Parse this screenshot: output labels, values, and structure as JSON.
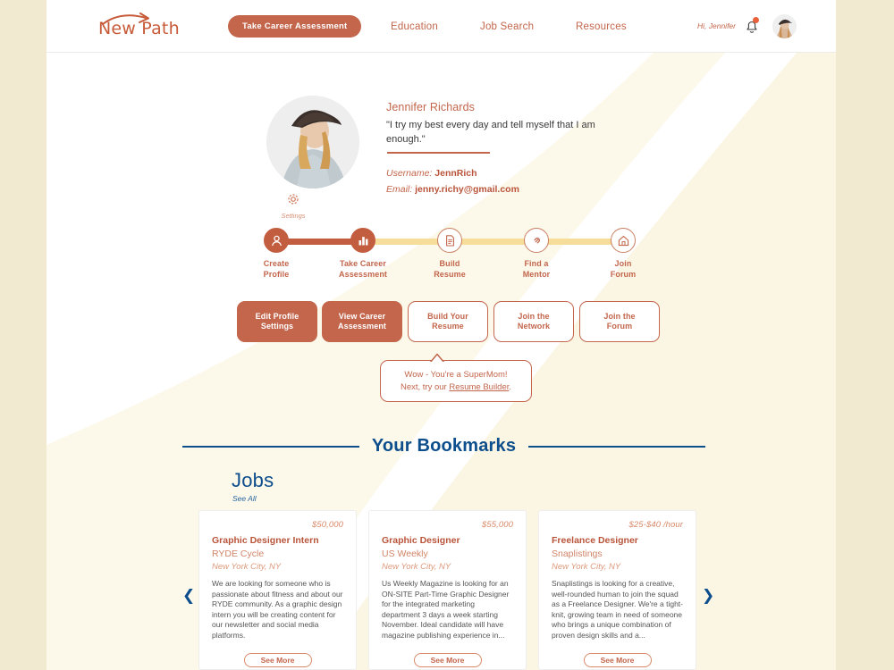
{
  "brand": {
    "name": "New Path",
    "accent": "#c3664c",
    "blue": "#0d4e8c",
    "cream": "#f2ead0",
    "gold": "#f6dd9a"
  },
  "header": {
    "logo_text": "New Path",
    "cta_label": "Take Career Assessment",
    "nav": [
      {
        "label": "Education"
      },
      {
        "label": "Job Search"
      },
      {
        "label": "Resources"
      }
    ],
    "greeting": "Hi, Jennifer",
    "bell_icon": "notification-bell-icon",
    "avatar_icon": "user-avatar"
  },
  "profile": {
    "name": "Jennifer Richards",
    "quote": "\"I try my best every day and tell myself that I am enough.\"",
    "username_label": "Username:",
    "username_value": "JennRich",
    "email_label": "Email:",
    "email_value": "jenny.richy@gmail.com",
    "settings_label": "Settings",
    "settings_icon": "gear-icon"
  },
  "stepper": {
    "steps": [
      {
        "label": "Create\nProfile",
        "icon": "person-icon",
        "state": "done"
      },
      {
        "label": "Take Career\nAssessment",
        "icon": "bar-chart-icon",
        "state": "done"
      },
      {
        "label": "Build\nResume",
        "icon": "document-icon",
        "state": "todo"
      },
      {
        "label": "Find a\nMentor",
        "icon": "link-icon",
        "state": "todo"
      },
      {
        "label": "Join\nForum",
        "icon": "home-icon",
        "state": "todo"
      }
    ]
  },
  "actions": [
    {
      "label": "Edit Profile\nSettings",
      "style": "solid"
    },
    {
      "label": "View Career\nAssessment",
      "style": "solid"
    },
    {
      "label": "Build Your\nResume",
      "style": "ghost"
    },
    {
      "label": "Join the\nNetwork",
      "style": "ghost"
    },
    {
      "label": "Join the\nForum",
      "style": "ghost"
    }
  ],
  "callout": {
    "line1": "Wow - You're a SuperMom!",
    "line2_pre": "Next, try our ",
    "link": "Resume Builder",
    "line2_post": "."
  },
  "bookmarks": {
    "title": "Your Bookmarks",
    "section_title": "Jobs",
    "see_all": "See All",
    "prev_icon": "chevron-left-icon",
    "next_icon": "chevron-right-icon",
    "see_more_label": "See More",
    "cards": [
      {
        "salary": "$50,000",
        "title": "Graphic Designer Intern",
        "company": "RYDE Cycle",
        "location": "New York City, NY",
        "description": "We are looking for someone who is passionate about fitness and about our RYDE community. As a graphic design intern you will be creating content for our newsletter and social media platforms."
      },
      {
        "salary": "$55,000",
        "title": "Graphic Designer",
        "company": "US Weekly",
        "location": "New York City, NY",
        "description": "Us Weekly Magazine is looking for an ON-SITE Part-Time Graphic Designer for the integrated marketing department 3 days a week starting November. Ideal candidate will have magazine publishing experience in..."
      },
      {
        "salary": "$25-$40 /hour",
        "title": "Freelance Designer",
        "company": "Snaplistings",
        "location": "New York City, NY",
        "description": "Snaplistings is looking for a creative, well-rounded human to join the squad as a Freelance Designer. We're a tight-knit, growing team in need of someone who brings a unique combination of proven design skills and a..."
      }
    ]
  }
}
